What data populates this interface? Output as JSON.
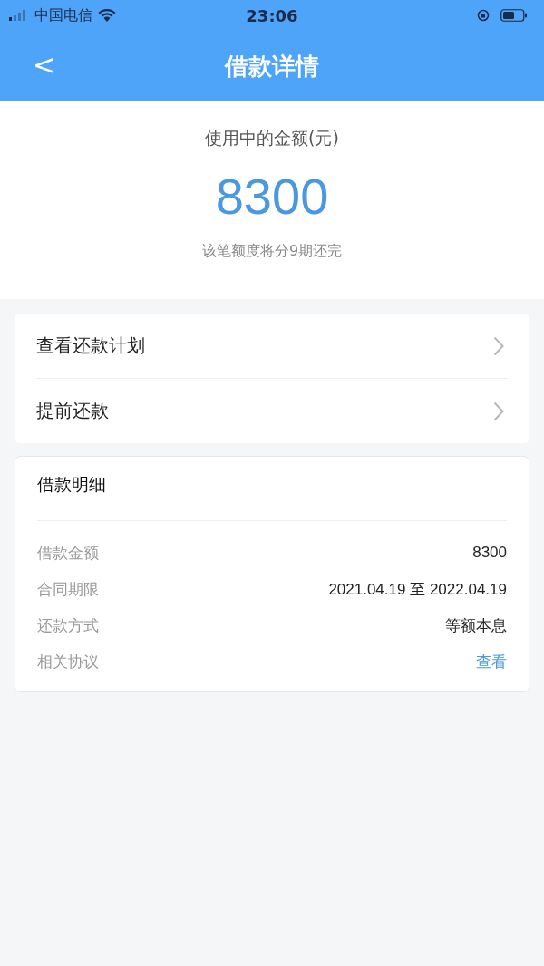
{
  "status_bar": {
    "carrier": "中国电信",
    "time": "23:06"
  },
  "nav": {
    "back": "<",
    "title": "借款详情"
  },
  "summary": {
    "label": "使用中的金额(元)",
    "amount": "8300",
    "note": "该笔额度将分9期还完"
  },
  "menu": [
    {
      "label": "查看还款计划"
    },
    {
      "label": "提前还款"
    }
  ],
  "details": {
    "title": "借款明细",
    "rows": [
      {
        "label": "借款金额",
        "value": "8300",
        "kind": "text"
      },
      {
        "label": "合同期限",
        "value": "2021.04.19 至 2022.04.19",
        "kind": "text"
      },
      {
        "label": "还款方式",
        "value": "等额本息",
        "kind": "text"
      },
      {
        "label": "相关协议",
        "value": "查看",
        "kind": "link"
      }
    ]
  }
}
